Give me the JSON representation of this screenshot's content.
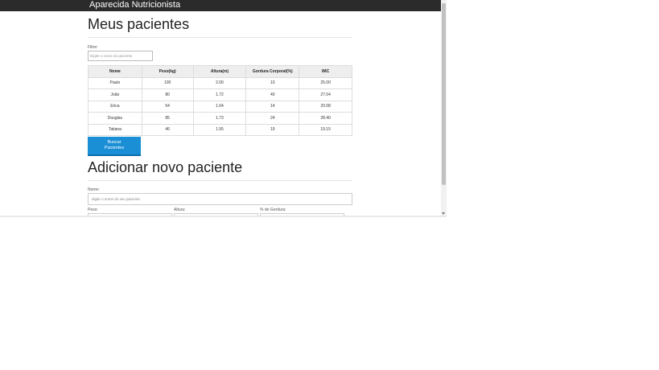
{
  "header": {
    "title": "Aparecida Nutricionista"
  },
  "main": {
    "heading": "Meus pacientes",
    "filter": {
      "label": "Filtre:",
      "placeholder": "Digite o nome do paciente"
    },
    "table": {
      "headers": [
        "Nome",
        "Peso(kg)",
        "Altura(m)",
        "Gordura Corporal(%)",
        "IMC"
      ],
      "rows": [
        [
          "Paulo",
          "100",
          "2.00",
          "10",
          "25.00"
        ],
        [
          "João",
          "80",
          "1.72",
          "40",
          "27.04"
        ],
        [
          "Erica",
          "54",
          "1.64",
          "14",
          "20.08"
        ],
        [
          "Douglas",
          "85",
          "1.73",
          "24",
          "28.40"
        ],
        [
          "Tatiana",
          "46",
          "1.55",
          "19",
          "19.15"
        ]
      ]
    },
    "search_button": "Buscar Pacientes"
  },
  "form": {
    "heading": "Adicionar novo paciente",
    "nome_label": "Nome:",
    "nome_placeholder": "digite o nome do seu paciente",
    "peso_label": "Peso:",
    "altura_label": "Altura:",
    "gordura_label": "% de Gordura:"
  }
}
